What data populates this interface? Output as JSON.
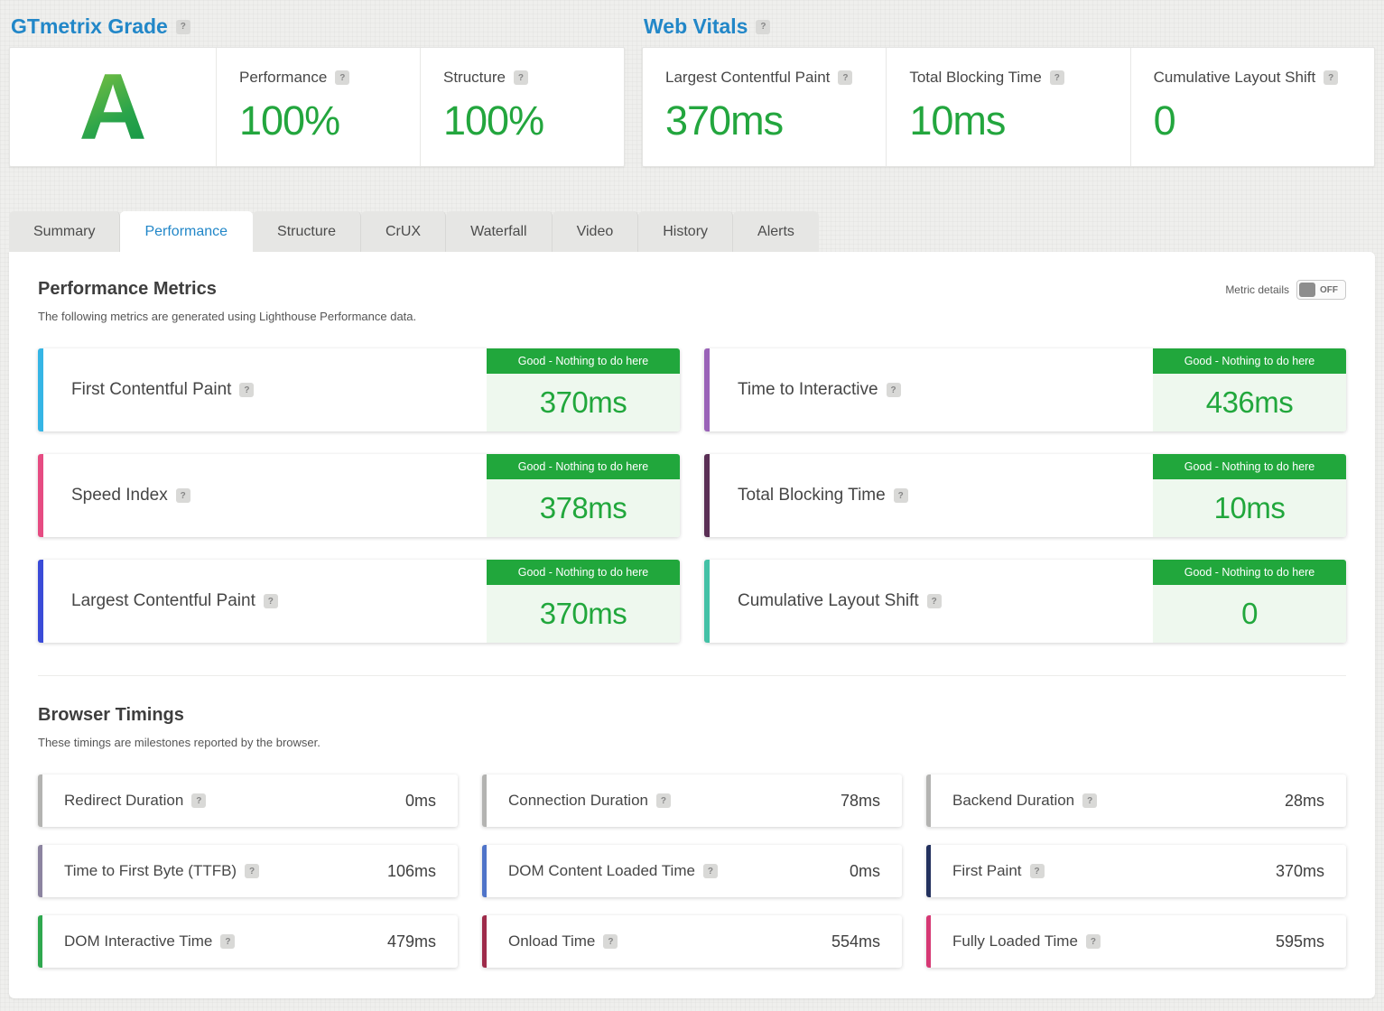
{
  "icons": {
    "help": "?"
  },
  "colors": {
    "brand_blue": "#2287c8",
    "good_green": "#23a63e",
    "status_green": "#21a73c"
  },
  "grade_section": {
    "title": "GTmetrix Grade",
    "grade": "A",
    "metrics": [
      {
        "label": "Performance",
        "value": "100%"
      },
      {
        "label": "Structure",
        "value": "100%"
      }
    ]
  },
  "vitals_section": {
    "title": "Web Vitals",
    "metrics": [
      {
        "label": "Largest Contentful Paint",
        "value": "370ms"
      },
      {
        "label": "Total Blocking Time",
        "value": "10ms"
      },
      {
        "label": "Cumulative Layout Shift",
        "value": "0"
      }
    ]
  },
  "tabs": [
    {
      "label": "Summary",
      "active": false
    },
    {
      "label": "Performance",
      "active": true
    },
    {
      "label": "Structure",
      "active": false
    },
    {
      "label": "CrUX",
      "active": false
    },
    {
      "label": "Waterfall",
      "active": false
    },
    {
      "label": "Video",
      "active": false
    },
    {
      "label": "History",
      "active": false
    },
    {
      "label": "Alerts",
      "active": false
    }
  ],
  "performance_metrics": {
    "title": "Performance Metrics",
    "subtitle": "The following metrics are generated using Lighthouse Performance data.",
    "toggle_label": "Metric details",
    "toggle_state": "OFF",
    "status_label": "Good - Nothing to do here",
    "cards": [
      {
        "label": "First Contentful Paint",
        "value": "370ms",
        "accent": "#35b5e5"
      },
      {
        "label": "Time to Interactive",
        "value": "436ms",
        "accent": "#9a63b8"
      },
      {
        "label": "Speed Index",
        "value": "378ms",
        "accent": "#e64c82"
      },
      {
        "label": "Total Blocking Time",
        "value": "10ms",
        "accent": "#5a2f55"
      },
      {
        "label": "Largest Contentful Paint",
        "value": "370ms",
        "accent": "#3a4bd8"
      },
      {
        "label": "Cumulative Layout Shift",
        "value": "0",
        "accent": "#43c1a6"
      }
    ]
  },
  "browser_timings": {
    "title": "Browser Timings",
    "subtitle": "These timings are milestones reported by the browser.",
    "cards": [
      {
        "label": "Redirect Duration",
        "value": "0ms",
        "accent": "#b3b3b1"
      },
      {
        "label": "Connection Duration",
        "value": "78ms",
        "accent": "#b3b3b1"
      },
      {
        "label": "Backend Duration",
        "value": "28ms",
        "accent": "#b3b3b1"
      },
      {
        "label": "Time to First Byte (TTFB)",
        "value": "106ms",
        "accent": "#8c84a0"
      },
      {
        "label": "DOM Content Loaded Time",
        "value": "0ms",
        "accent": "#4f74c9"
      },
      {
        "label": "First Paint",
        "value": "370ms",
        "accent": "#23315e"
      },
      {
        "label": "DOM Interactive Time",
        "value": "479ms",
        "accent": "#2fa84f"
      },
      {
        "label": "Onload Time",
        "value": "554ms",
        "accent": "#9e2b4a"
      },
      {
        "label": "Fully Loaded Time",
        "value": "595ms",
        "accent": "#d63874"
      }
    ]
  }
}
